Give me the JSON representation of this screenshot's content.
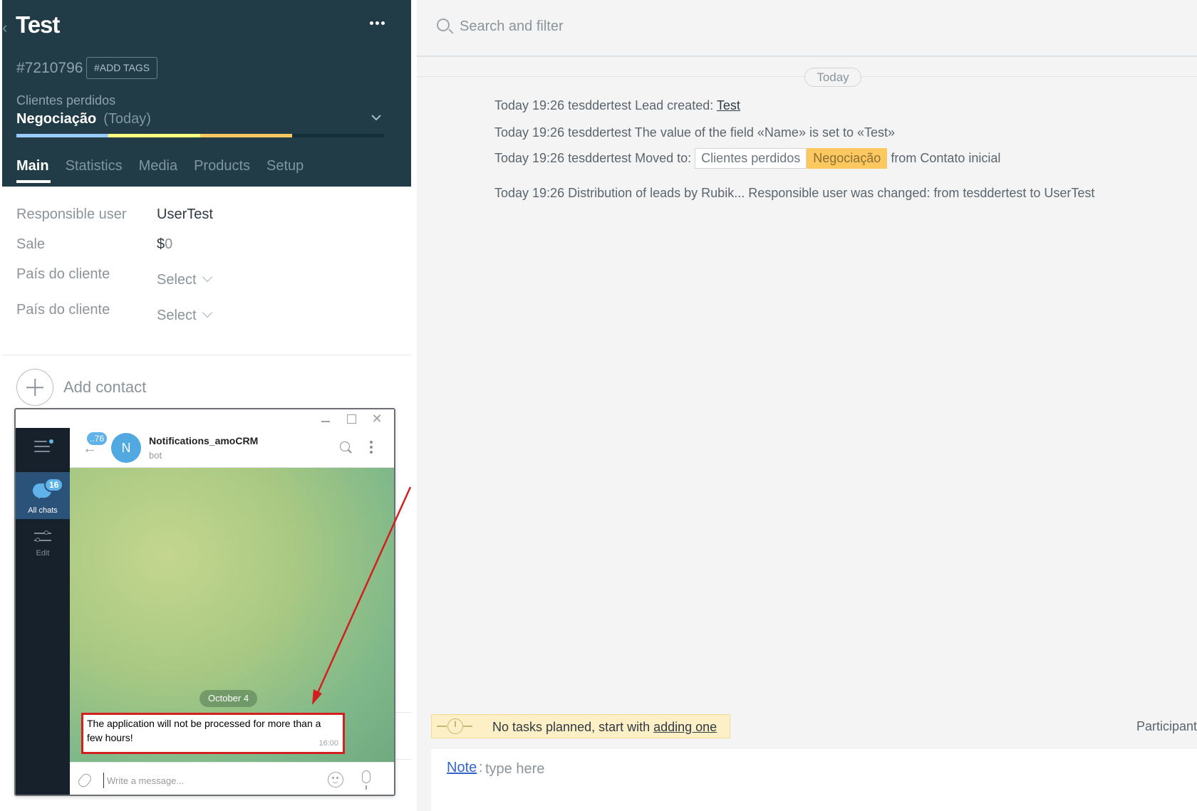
{
  "lead": {
    "title": "Test",
    "id": "#7210796",
    "add_tags_label": "#ADD TAGS",
    "pipeline": "Clientes perdidos",
    "stage": "Negociação",
    "stage_when": "(Today)",
    "stage_progress_segments": [
      {
        "color": "#99ccfd",
        "fraction": 0.25
      },
      {
        "color": "#fffd7f",
        "fraction": 0.25
      },
      {
        "color": "#fcc85f",
        "fraction": 0.25
      },
      {
        "color": "#143039",
        "fraction": 0.25
      }
    ]
  },
  "tabs": [
    {
      "label": "Main",
      "active": true
    },
    {
      "label": "Statistics",
      "active": false
    },
    {
      "label": "Media",
      "active": false
    },
    {
      "label": "Products",
      "active": false
    },
    {
      "label": "Setup",
      "active": false
    }
  ],
  "fields": [
    {
      "label": "Responsible user",
      "value": "UserTest",
      "muted": false
    },
    {
      "label": "Sale",
      "value_currency": "$",
      "value": "0",
      "muted": true
    },
    {
      "label": "País do cliente",
      "value": "Select",
      "muted": true,
      "select": true
    },
    {
      "label": "País do cliente",
      "value": "Select",
      "muted": true,
      "select": true
    }
  ],
  "add_contact_label": "Add contact",
  "search": {
    "placeholder": "Search and filter"
  },
  "feed": {
    "date_label": "Today",
    "entries": [
      {
        "prefix": "Today 19:26 tesddertest Lead created: ",
        "link": "Test"
      },
      {
        "text": "Today 19:26 tesddertest The value of the field «Name» is set to «Test»"
      },
      {
        "prefix": "Today 19:26 tesddertest Moved to: ",
        "tag_from_pipeline": "Clientes perdidos",
        "tag_stage": "Negociação",
        "suffix": " from Contato inicial"
      },
      {
        "text": "Today 19:26 Distribution of leads by Rubik...  Responsible user was changed: from tesddertest to UserTest"
      }
    ]
  },
  "tasks": {
    "text": "No tasks planned, start with ",
    "link": "adding one"
  },
  "participants_label": "Participant",
  "note": {
    "label": "Note",
    "placeholder": "type here"
  },
  "telegram": {
    "chat_name": "Notifications_amoCRM",
    "chat_sub": "bot",
    "avatar_letter": "N",
    "back_badge": "..76",
    "all_chats_badge": "16",
    "all_chats_label": "All chats",
    "edit_label": "Edit",
    "date_pill": "October 4",
    "message_text": "The application will not be processed for more than a few hours!",
    "message_time": "16:00",
    "input_placeholder": "Write a message..."
  },
  "colors": {
    "header_bg": "#213b47",
    "accent_stage": "#fcc85f",
    "highlight_border": "#d21f1f",
    "link_blue": "#3366cc"
  }
}
